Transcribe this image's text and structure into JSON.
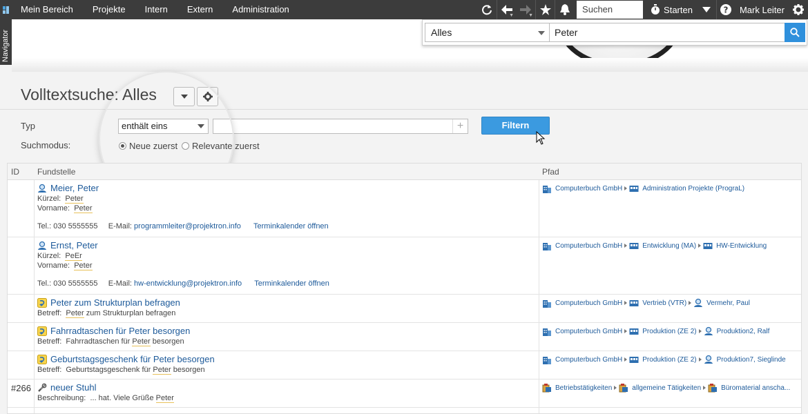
{
  "topnav": {
    "items": [
      "Mein Bereich",
      "Projekte",
      "Intern",
      "Extern",
      "Administration"
    ],
    "search_value": "Suchen",
    "start_label": "Starten",
    "user_name": "Mark Leiter"
  },
  "navigator_label": "Navigator",
  "search_overlay": {
    "scope": "Alles",
    "query": "Peter"
  },
  "page": {
    "title": "Volltextsuche: Alles"
  },
  "filter": {
    "type_label": "Typ",
    "type_operator": "enthält eins",
    "type_value": "",
    "mode_label": "Suchmodus:",
    "mode_options": [
      "Neue zuerst",
      "Relevante zuerst"
    ],
    "selected_mode": "Neue zuerst",
    "button": "Filtern"
  },
  "table": {
    "headers": [
      "ID",
      "Fundstelle",
      "Pfad"
    ],
    "rows": [
      {
        "id": "",
        "title": "Meier, Peter",
        "icon": "person-icon",
        "lines": [
          [
            "Kürzel:",
            "Peter"
          ],
          [
            "Vorname:",
            "Peter"
          ]
        ],
        "tel": "Tel.: 030 5555555",
        "email_label": "E-Mail:",
        "email": "programmleiter@projektron.info",
        "calendar": "Terminkalender öffnen",
        "path": [
          "Computerbuch GmbH",
          "Administration Projekte (PrograL)"
        ]
      },
      {
        "id": "",
        "title": "Ernst, Peter",
        "icon": "person-icon",
        "lines": [
          [
            "Kürzel:",
            "PeEr"
          ],
          [
            "Vorname:",
            "Peter"
          ]
        ],
        "tel": "Tel.: 030 5555555",
        "email_label": "E-Mail:",
        "email": "hw-entwicklung@projektron.info",
        "calendar": "Terminkalender öffnen",
        "path": [
          "Computerbuch GmbH",
          "Entwicklung (MA)",
          "HW-Entwicklung"
        ]
      },
      {
        "id": "",
        "title": "Peter zum Strukturplan befragen",
        "icon": "task-icon",
        "betreff_label": "Betreff:",
        "betreff_pre": "",
        "betreff_hl": "Peter",
        "betreff_post": " zum Strukturplan befragen",
        "path": [
          "Computerbuch GmbH",
          "Vertrieb (VTR)",
          "Vermehr, Paul"
        ]
      },
      {
        "id": "",
        "title": "Fahrradtaschen für Peter besorgen",
        "icon": "task-icon",
        "betreff_label": "Betreff:",
        "betreff_pre": "Fahrradtaschen für ",
        "betreff_hl": "Peter",
        "betreff_post": " besorgen",
        "path": [
          "Computerbuch GmbH",
          "Produktion (ZE 2)",
          "Produktion2, Ralf"
        ]
      },
      {
        "id": "",
        "title": "Geburtstagsgeschenk für Peter besorgen",
        "icon": "task-icon",
        "betreff_label": "Betreff:",
        "betreff_pre": "Geburtstagsgeschenk für ",
        "betreff_hl": "Peter",
        "betreff_post": " besorgen",
        "path": [
          "Computerbuch GmbH",
          "Produktion (ZE 2)",
          "Produktion7, Sieglinde"
        ]
      },
      {
        "id": "#266",
        "title": "neuer Stuhl",
        "icon": "tools-icon",
        "betreff_label": "Beschreibung:",
        "betreff_pre": "...  hat. Viele Grüße ",
        "betreff_hl": "Peter",
        "betreff_post": "",
        "path": [
          "Betriebstätigkeiten",
          "allgemeine Tätigkeiten",
          "Büromaterial anscha..."
        ]
      }
    ]
  }
}
